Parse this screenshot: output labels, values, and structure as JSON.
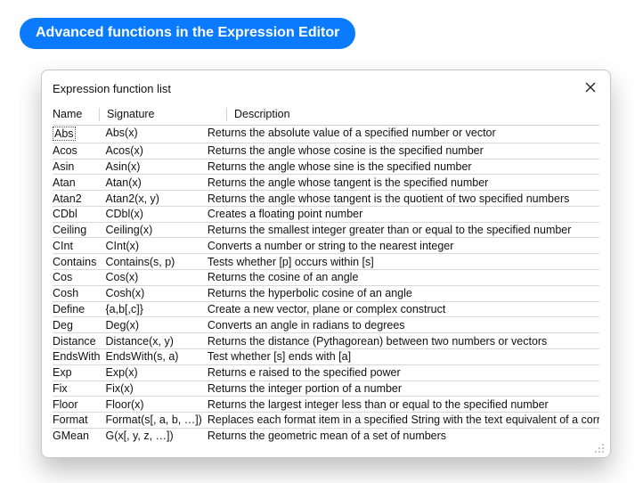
{
  "heading": "Advanced functions in the Expression Editor",
  "dialog": {
    "title": "Expression function list",
    "columns": {
      "name": "Name",
      "signature": "Signature",
      "description": "Description"
    },
    "rows": [
      {
        "name": "Abs",
        "sig": "Abs(x)",
        "desc": "Returns the absolute value of a specified number or vector"
      },
      {
        "name": "Acos",
        "sig": "Acos(x)",
        "desc": "Returns the angle whose cosine is the specified number"
      },
      {
        "name": "Asin",
        "sig": "Asin(x)",
        "desc": "Returns the angle whose sine is the specified number"
      },
      {
        "name": "Atan",
        "sig": "Atan(x)",
        "desc": "Returns the angle whose tangent is the specified number"
      },
      {
        "name": "Atan2",
        "sig": "Atan2(x, y)",
        "desc": "Returns the angle whose tangent is the quotient of two specified numbers"
      },
      {
        "name": "CDbl",
        "sig": "CDbl(x)",
        "desc": "Creates a floating point number"
      },
      {
        "name": "Ceiling",
        "sig": "Ceiling(x)",
        "desc": "Returns the smallest integer greater than or equal to the specified number"
      },
      {
        "name": "CInt",
        "sig": "CInt(x)",
        "desc": "Converts a number or string to the nearest integer"
      },
      {
        "name": "Contains",
        "sig": "Contains(s, p)",
        "desc": "Tests whether [p] occurs within [s]"
      },
      {
        "name": "Cos",
        "sig": "Cos(x)",
        "desc": "Returns the cosine of an angle"
      },
      {
        "name": "Cosh",
        "sig": "Cosh(x)",
        "desc": "Returns the hyperbolic cosine of an angle"
      },
      {
        "name": "Define",
        "sig": "{a,b[,c]}",
        "desc": "Create a new vector, plane or complex construct"
      },
      {
        "name": "Deg",
        "sig": "Deg(x)",
        "desc": "Converts an angle in radians to degrees"
      },
      {
        "name": "Distance",
        "sig": "Distance(x, y)",
        "desc": "Returns the distance (Pythagorean) between two numbers or vectors"
      },
      {
        "name": "EndsWith",
        "sig": "EndsWith(s, a)",
        "desc": "Test whether [s] ends with [a]"
      },
      {
        "name": "Exp",
        "sig": "Exp(x)",
        "desc": "Returns e raised to the specified power"
      },
      {
        "name": "Fix",
        "sig": "Fix(x)",
        "desc": "Returns the integer portion of a number"
      },
      {
        "name": "Floor",
        "sig": "Floor(x)",
        "desc": "Returns the largest integer less than or equal to the specified number"
      },
      {
        "name": "Format",
        "sig": "Format(s[, a, b, …])",
        "desc": "Replaces each format item in a specified String with the text equivalent of a corresponding value"
      },
      {
        "name": "GMean",
        "sig": "G(x[, y, z, …])",
        "desc": "Returns the geometric mean of a set of numbers"
      }
    ]
  }
}
